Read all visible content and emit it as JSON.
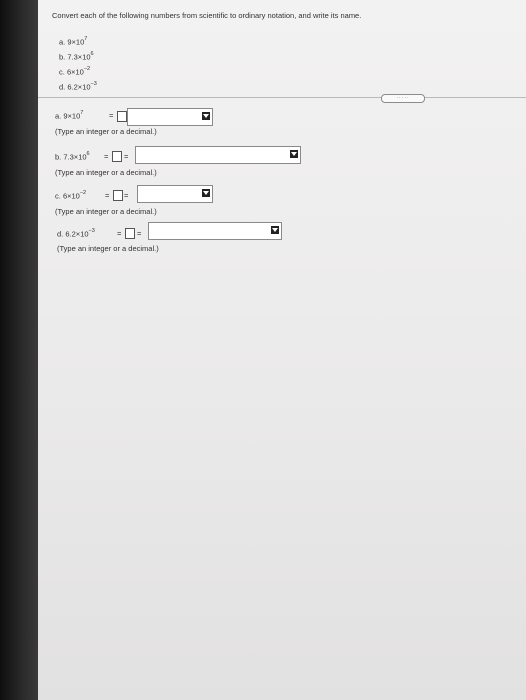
{
  "instruction": "Convert each of the following numbers from scientific to ordinary notation, and write its name.",
  "questions": [
    {
      "label": "a.",
      "coef": "9",
      "times": "×",
      "base": "10",
      "exp": "7"
    },
    {
      "label": "b.",
      "coef": "7.3",
      "times": "×",
      "base": "10",
      "exp": "6"
    },
    {
      "label": "c.",
      "coef": "6",
      "times": "×",
      "base": "10",
      "exp": "−2"
    },
    {
      "label": "d.",
      "coef": "6.2",
      "times": "×",
      "base": "10",
      "exp": "−3"
    }
  ],
  "expand_pill": "·····",
  "answers": [
    {
      "label": "a.",
      "coef": "9",
      "times": "×",
      "base": "10",
      "exp": "7",
      "eq1": "=",
      "eq2": "=",
      "hint": "(Type an integer or a decimal.)"
    },
    {
      "label": "b.",
      "coef": "7.3",
      "times": "×",
      "base": "10",
      "exp": "6",
      "eq1": "=",
      "eq2": "=",
      "hint": "(Type an integer or a decimal.)"
    },
    {
      "label": "c.",
      "coef": "6",
      "times": "×",
      "base": "10",
      "exp": "−2",
      "eq1": "=",
      "eq2": "=",
      "hint": "(Type an integer or a decimal.)"
    },
    {
      "label": "d.",
      "coef": "6.2",
      "times": "×",
      "base": "10",
      "exp": "−3",
      "eq1": "=",
      "eq2": "=",
      "hint": "(Type an integer or a decimal.)"
    }
  ]
}
